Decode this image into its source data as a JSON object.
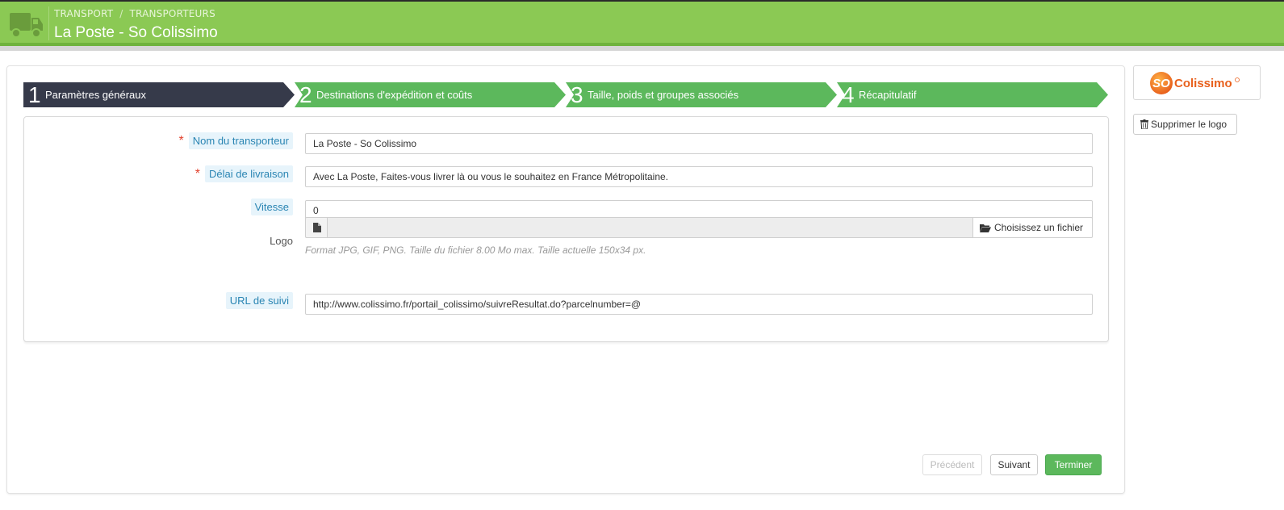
{
  "header": {
    "breadcrumb": [
      "TRANSPORT",
      "TRANSPORTEURS"
    ],
    "breadcrumb_sep": "/",
    "title": "La Poste - So Colissimo",
    "icon": "truck-icon"
  },
  "colors": {
    "header_bg": "#8bc954",
    "step_active": "#363a4a",
    "step_inactive": "#5cb85c",
    "label_accent": "#2a85b3",
    "required": "#e2402c"
  },
  "steps": [
    {
      "num": "1",
      "label": "Paramètres généraux",
      "active": true
    },
    {
      "num": "2",
      "label": "Destinations d'expédition et coûts",
      "active": false
    },
    {
      "num": "3",
      "label": "Taille, poids et groupes associés",
      "active": false
    },
    {
      "num": "4",
      "label": "Récapitulatif",
      "active": false
    }
  ],
  "form": {
    "name_label": "Nom du transporteur",
    "name_value": "La Poste - So Colissimo",
    "delay_label": "Délai de livraison",
    "delay_value": "Avec La Poste, Faites-vous livrer là ou vous le souhaitez en France Métropolitaine.",
    "speed_label": "Vitesse",
    "speed_value": "0",
    "logo_label": "Logo",
    "logo_button": "Choisissez un fichier",
    "logo_help": "Format JPG, GIF, PNG. Taille du fichier 8.00 Mo max. Taille actuelle 150x34 px.",
    "url_label": "URL de suivi",
    "url_value": "http://www.colissimo.fr/portail_colissimo/suivreResultat.do?parcelnumber=@",
    "required_mark": "*"
  },
  "buttons": {
    "prev": "Précédent",
    "next": "Suivant",
    "finish": "Terminer"
  },
  "sidebar": {
    "logo_so": "SO",
    "logo_text": "Colissimo",
    "delete_logo": "Supprimer le logo"
  }
}
